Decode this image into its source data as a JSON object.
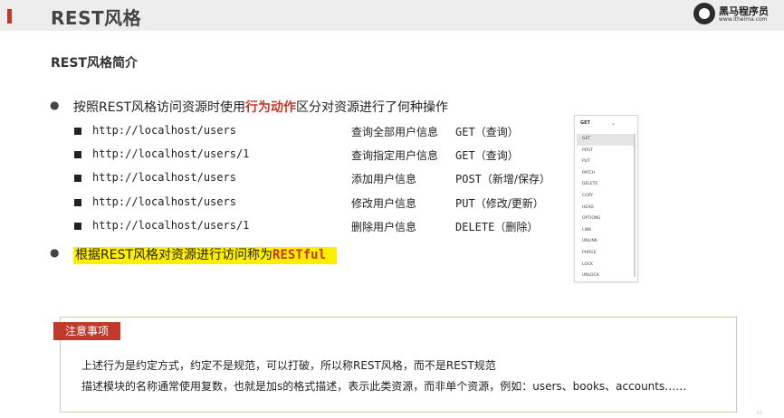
{
  "slide": {
    "title": "REST风格",
    "section_title": "REST风格简介",
    "logo": {
      "name": "黑马程序员",
      "url": "www.itheima.com"
    }
  },
  "bullets": {
    "first": {
      "prefix": "按照REST风格访问资源时使用",
      "highlight": "行为动作",
      "suffix": "区分对资源进行了何种操作"
    },
    "second": {
      "prefix": "根据REST风格对资源进行访问称为",
      "code": "RESTful"
    }
  },
  "rows": [
    {
      "url": "http://localhost/users",
      "desc": "查询全部用户信息",
      "method": "GET",
      "note": "（查询）"
    },
    {
      "url": "http://localhost/users/1",
      "desc": "查询指定用户信息",
      "method": "GET",
      "note": "（查询）"
    },
    {
      "url": "http://localhost/users",
      "desc": "添加用户信息",
      "method": "POST",
      "note": "（新增/保存）"
    },
    {
      "url": "http://localhost/users",
      "desc": "修改用户信息",
      "method": "PUT",
      "note": "（修改/更新）"
    },
    {
      "url": "http://localhost/users/1",
      "desc": "删除用户信息",
      "method": "DELETE",
      "note": "（删除）"
    }
  ],
  "method_dropdown": {
    "selected": "GET",
    "options": [
      "GET",
      "POST",
      "PUT",
      "PATCH",
      "DELETE",
      "COPY",
      "HEAD",
      "OPTIONS",
      "LINK",
      "UNLINK",
      "PURGE",
      "LOCK",
      "UNLOCK"
    ]
  },
  "note": {
    "tag": "注意事项",
    "line1": "上述行为是约定方式，约定不是规范，可以打破，所以称REST风格，而不是REST规范",
    "line2": "描述模块的名称通常使用复数，也就是加s的格式描述，表示此类资源，而非单个资源，例如：users、books、accounts……"
  },
  "page_number": "48",
  "colors": {
    "accent": "#c0392b",
    "highlight": "#ffee00",
    "header_bg": "#ededed"
  }
}
